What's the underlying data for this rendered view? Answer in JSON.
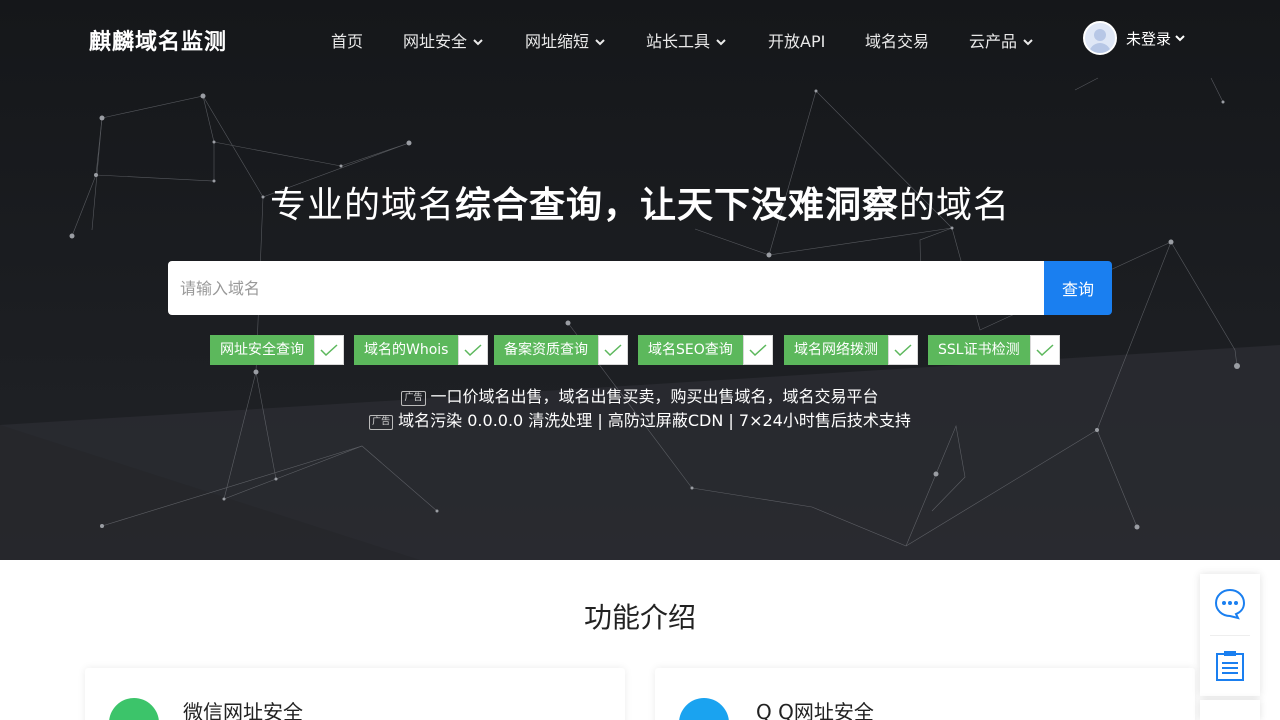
{
  "brand": {
    "logo": "麒麟域名监测"
  },
  "nav": [
    {
      "label": "首页",
      "has_dropdown": false
    },
    {
      "label": "网址安全",
      "has_dropdown": true
    },
    {
      "label": "网址缩短",
      "has_dropdown": true
    },
    {
      "label": "站长工具",
      "has_dropdown": true
    },
    {
      "label": "开放API",
      "has_dropdown": false
    },
    {
      "label": "域名交易",
      "has_dropdown": false
    },
    {
      "label": "云产品",
      "has_dropdown": true
    }
  ],
  "user": {
    "status": "未登录",
    "avatar_icon": "user-avatar-icon"
  },
  "hero": {
    "headline_part1": "专业的域名",
    "headline_part2": "综合查询，让天下没难洞察",
    "headline_part3": "的域名"
  },
  "search": {
    "placeholder": "请输入域名",
    "button_label": "查询"
  },
  "check_options": [
    {
      "label": "网址安全查询",
      "checked": true
    },
    {
      "label": "域名的Whois",
      "checked": true
    },
    {
      "label": "备案资质查询",
      "checked": true
    },
    {
      "label": "域名SEO查询",
      "checked": true
    },
    {
      "label": "域名网络拨测",
      "checked": true
    },
    {
      "label": "SSL证书检测",
      "checked": true
    }
  ],
  "ads": [
    {
      "tag": "广告",
      "text": "一口价域名出售，域名出售买卖，购买出售域名，域名交易平台"
    },
    {
      "tag": "广告",
      "text": "域名污染 0.0.0.0 清洗处理 | 高防过屏蔽CDN | 7×24小时售后技术支持"
    }
  ],
  "features": {
    "title": "功能介绍",
    "cards": [
      {
        "title": "微信网址安全",
        "icon": "wechat-icon",
        "color": "#3cc46a"
      },
      {
        "title": "Q Q网址安全",
        "icon": "qq-icon",
        "color": "#1aa3f0"
      }
    ]
  },
  "side_panel": [
    {
      "icon": "chat-bubble-icon"
    },
    {
      "icon": "clipboard-icon"
    }
  ],
  "colors": {
    "accent": "#1a7ff0",
    "option_green": "#5cb85c",
    "hero_bg": "#1c1e22"
  }
}
